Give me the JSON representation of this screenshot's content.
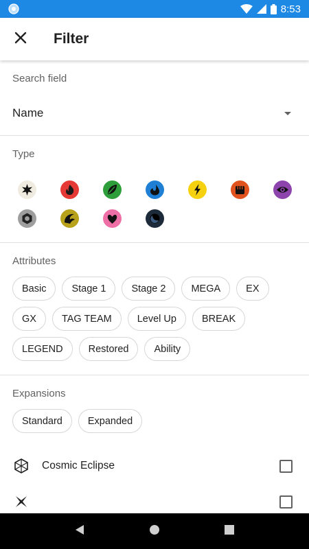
{
  "status_bar": {
    "time": "8:53"
  },
  "app_bar": {
    "title": "Filter"
  },
  "search_field": {
    "title": "Search field",
    "value": "Name"
  },
  "type_section": {
    "title": "Type",
    "types": [
      {
        "name": "colorless-type-icon",
        "color": "#efebe0"
      },
      {
        "name": "fire-type-icon",
        "color": "#e53935"
      },
      {
        "name": "grass-type-icon",
        "color": "#2e9e3a"
      },
      {
        "name": "water-type-icon",
        "color": "#1e7fd4"
      },
      {
        "name": "lightning-type-icon",
        "color": "#f5d10f"
      },
      {
        "name": "fighting-type-icon",
        "color": "#e0531f"
      },
      {
        "name": "psychic-type-icon",
        "color": "#8e44ad"
      },
      {
        "name": "metal-type-icon",
        "color": "#9e9e9e"
      },
      {
        "name": "dragon-type-icon",
        "color": "#b8a21c"
      },
      {
        "name": "fairy-type-icon",
        "color": "#ee6fa5"
      },
      {
        "name": "darkness-type-icon",
        "color": "#1c2a3a"
      }
    ]
  },
  "attributes": {
    "title": "Attributes",
    "chips": [
      "Basic",
      "Stage 1",
      "Stage 2",
      "MEGA",
      "EX",
      "GX",
      "TAG TEAM",
      "Level Up",
      "BREAK",
      "LEGEND",
      "Restored",
      "Ability"
    ]
  },
  "expansions": {
    "title": "Expansions",
    "chips": [
      "Standard",
      "Expanded"
    ],
    "items": [
      {
        "label": "Cosmic Eclipse",
        "checked": false
      }
    ]
  }
}
